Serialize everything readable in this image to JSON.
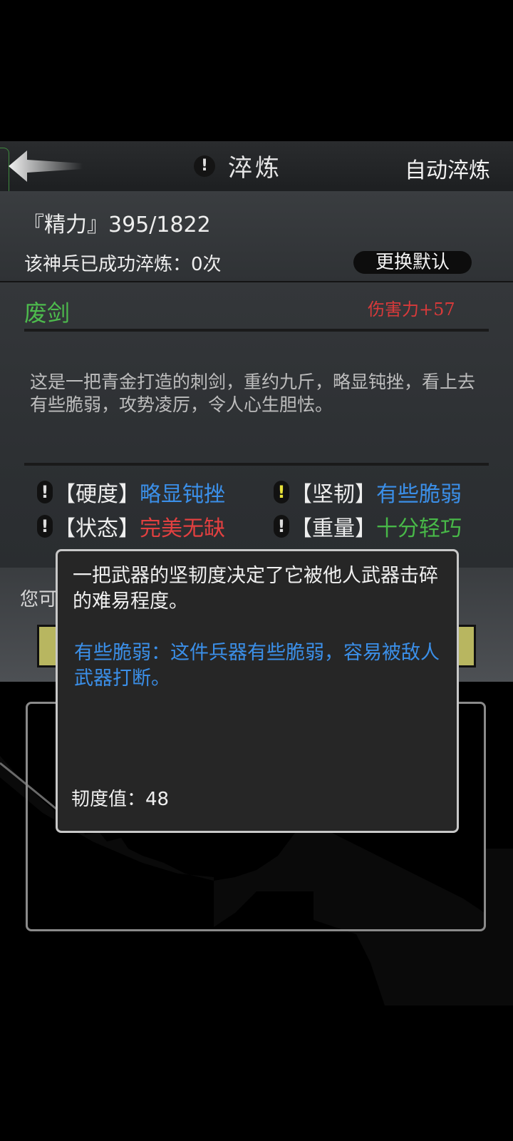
{
  "header": {
    "title": "淬炼",
    "alert_glyph": "!",
    "auto_refine_label": "自动淬炼"
  },
  "info": {
    "energy": "『精力』395/1822",
    "refine_count": "该神兵已成功淬炼：0次",
    "change_default_label": "更换默认"
  },
  "weapon": {
    "name": "废剑",
    "damage": "伤害力+57",
    "description": "这是一把青金打造的刺剑，重约九斤，略显钝挫，看上去有些脆弱，攻势凌厉，令人心生胆怯。",
    "attributes": [
      {
        "label": "【硬度】",
        "value": "略显钝挫",
        "color": "#3b8fe8"
      },
      {
        "label": "【坚韧】",
        "value": "有些脆弱",
        "color": "#3b8fe8"
      },
      {
        "label": "【状态】",
        "value": "完美无缺",
        "color": "#e24040"
      },
      {
        "label": "【重量】",
        "value": "十分轻巧",
        "color": "#48b848"
      }
    ]
  },
  "lower": {
    "hint": "您可"
  },
  "tooltip": {
    "description": "一把武器的坚韧度决定了它被他人武器击碎的难易程度。",
    "detail": "有些脆弱：这件兵器有些脆弱，容易被敌人武器打断。",
    "value": "韧度值：48"
  }
}
